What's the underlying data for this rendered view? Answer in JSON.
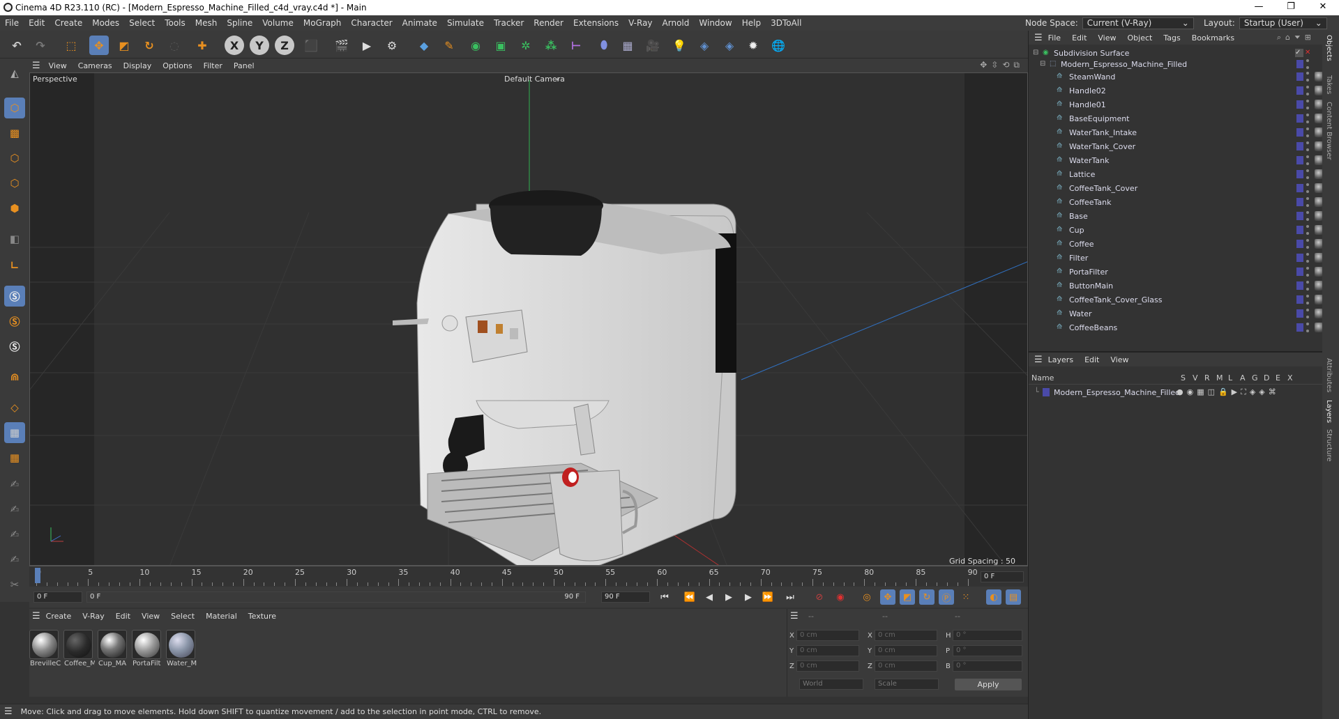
{
  "window": {
    "title": "Cinema 4D R23.110 (RC) - [Modern_Espresso_Machine_Filled_c4d_vray.c4d *] - Main",
    "minimize": "—",
    "maximize": "❐",
    "close": "✕"
  },
  "menu": [
    "File",
    "Edit",
    "Create",
    "Modes",
    "Select",
    "Tools",
    "Mesh",
    "Spline",
    "Volume",
    "MoGraph",
    "Character",
    "Animate",
    "Simulate",
    "Tracker",
    "Render",
    "Extensions",
    "V-Ray",
    "Arnold",
    "Window",
    "Help",
    "3DToAll"
  ],
  "nodespace": {
    "label": "Node Space:",
    "value": "Current (V-Ray)"
  },
  "layout": {
    "label": "Layout:",
    "value": "Startup (User)"
  },
  "viewport": {
    "menu": [
      "View",
      "Cameras",
      "Display",
      "Options",
      "Filter",
      "Panel"
    ],
    "name": "Perspective",
    "camera": "Default Camera",
    "grid_spacing": "Grid Spacing : 50 cm"
  },
  "timeline": {
    "ticks": [
      "0",
      "5",
      "10",
      "15",
      "20",
      "25",
      "30",
      "35",
      "40",
      "45",
      "50",
      "55",
      "60",
      "65",
      "70",
      "75",
      "80",
      "85",
      "90"
    ],
    "current_frame": "0 F",
    "start": "0 F",
    "range_start": "0 F",
    "range_end": "90 F",
    "end": "90 F"
  },
  "materials": {
    "menu": [
      "Create",
      "V-Ray",
      "Edit",
      "View",
      "Select",
      "Material",
      "Texture"
    ],
    "items": [
      "BrevilleC",
      "Coffee_M",
      "Cup_MA",
      "PortaFilt",
      "Water_M"
    ]
  },
  "coords": {
    "headers": [
      "--",
      "--",
      "--"
    ],
    "rows": [
      {
        "a": "X",
        "av": "0 cm",
        "b": "X",
        "bv": "0 cm",
        "c": "H",
        "cv": "0 °"
      },
      {
        "a": "Y",
        "av": "0 cm",
        "b": "Y",
        "bv": "0 cm",
        "c": "P",
        "cv": "0 °"
      },
      {
        "a": "Z",
        "av": "0 cm",
        "b": "Z",
        "bv": "0 cm",
        "c": "B",
        "cv": "0 °"
      }
    ],
    "world": "World",
    "scale": "Scale",
    "apply": "Apply"
  },
  "status": "Move: Click and drag to move elements. Hold down SHIFT to quantize movement / add to the selection in point mode, CTRL to remove.",
  "objects": {
    "menu": [
      "File",
      "Edit",
      "View",
      "Object",
      "Tags",
      "Bookmarks"
    ],
    "root": "Subdivision Surface",
    "group": "Modern_Espresso_Machine_Filled",
    "children": [
      "SteamWand",
      "Handle02",
      "Handle01",
      "BaseEquipment",
      "WaterTank_Intake",
      "WaterTank_Cover",
      "WaterTank",
      "Lattice",
      "CoffeeTank_Cover",
      "CoffeeTank",
      "Base",
      "Cup",
      "Coffee",
      "Filter",
      "PortaFilter",
      "ButtonMain",
      "CoffeeTank_Cover_Glass",
      "Water",
      "CoffeeBeans"
    ]
  },
  "layers": {
    "menu": [
      "Layers",
      "Edit",
      "View"
    ],
    "col_name": "Name",
    "cols": [
      "S",
      "V",
      "R",
      "M",
      "L",
      "A",
      "G",
      "D",
      "E",
      "X"
    ],
    "items": [
      "Modern_Espresso_Machine_Filled"
    ]
  },
  "sidetabs": [
    "Objects",
    "Takes",
    "Content Browser",
    "Attributes",
    "Layers",
    "Structure"
  ],
  "accent": "#5a7fb8"
}
